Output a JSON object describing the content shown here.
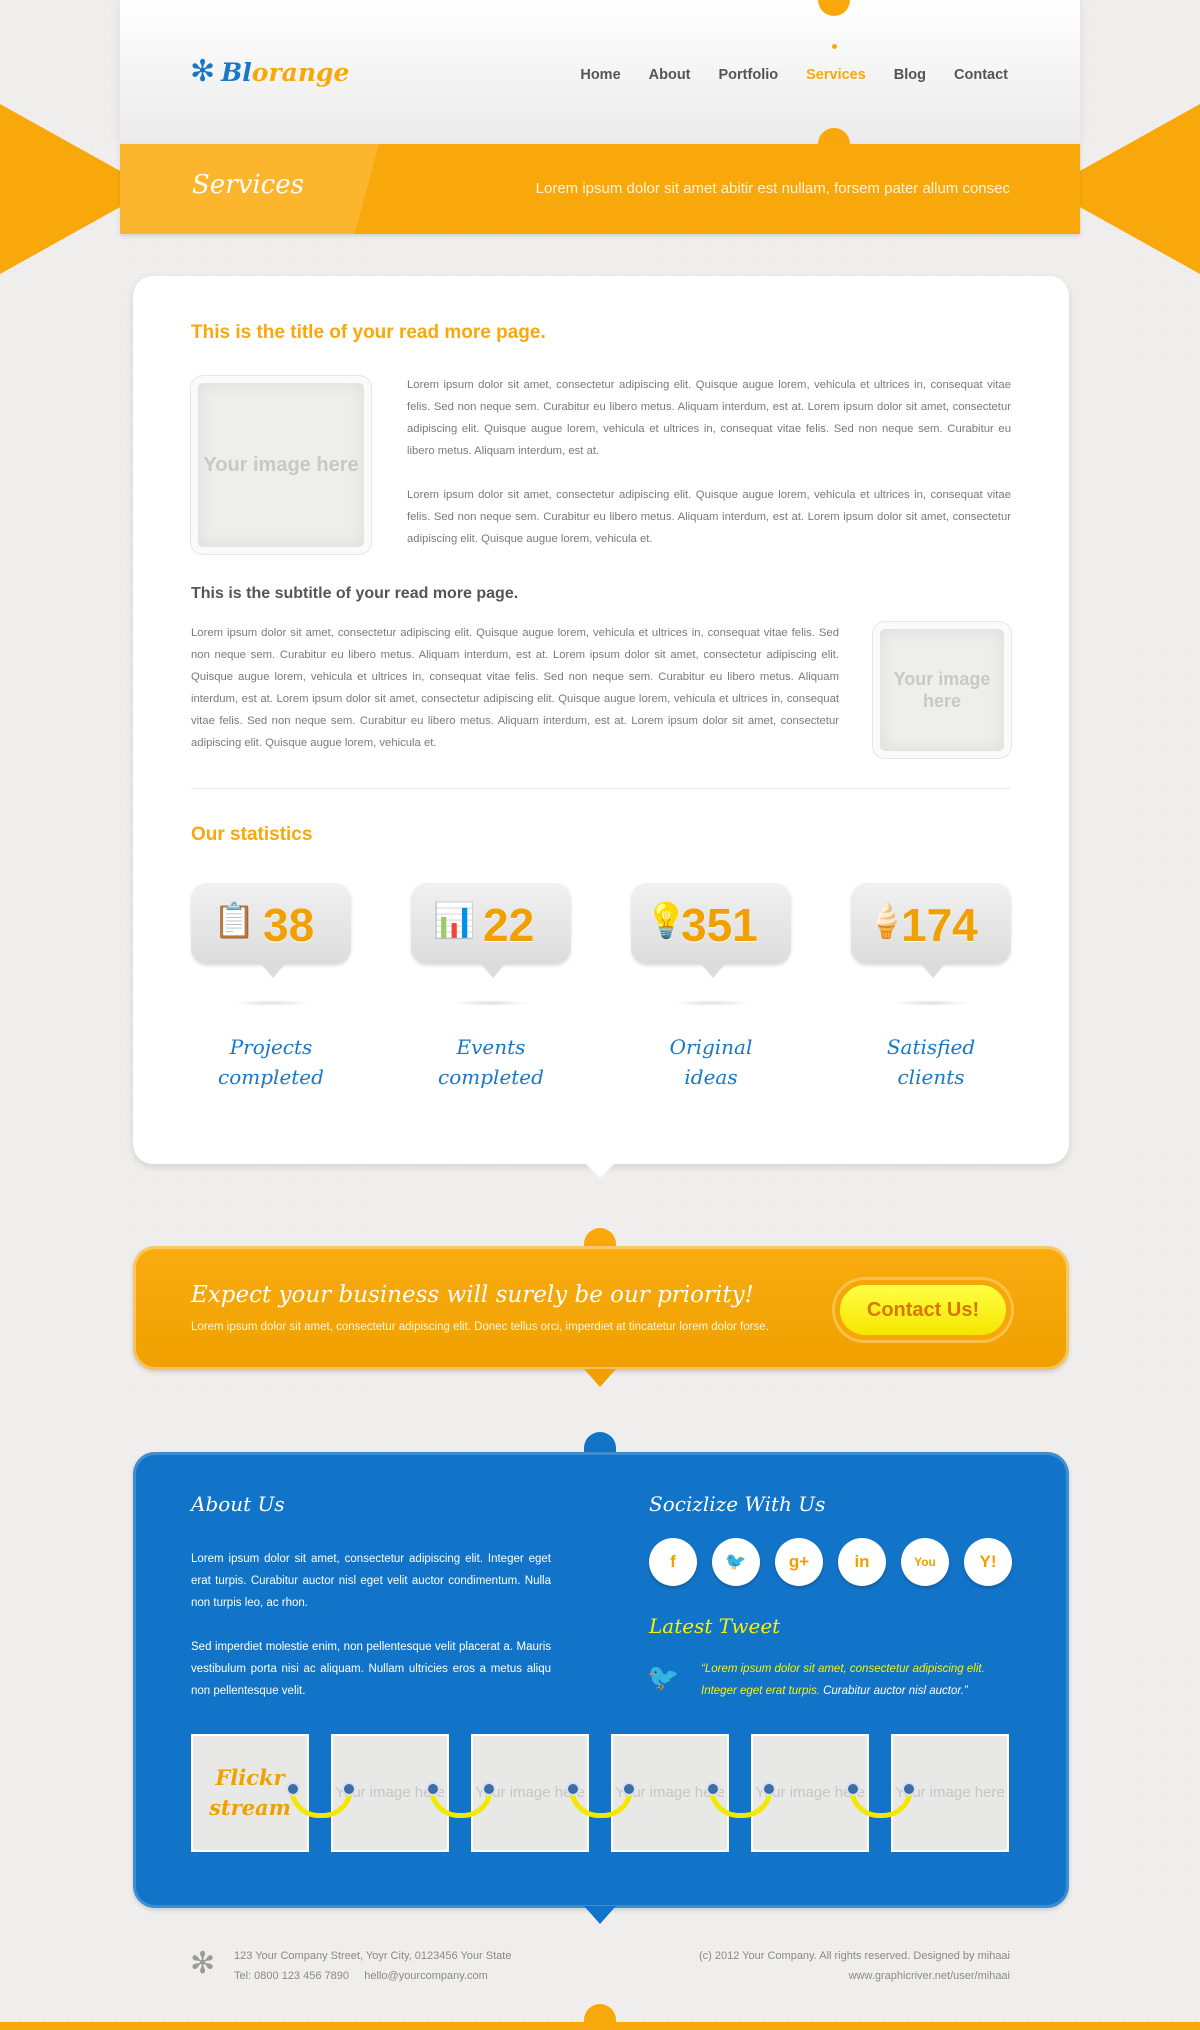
{
  "header": {
    "logo_part1": "Bl",
    "logo_part2": "orange",
    "logo_icon": "flower-icon",
    "nav": [
      "Home",
      "About",
      "Portfolio",
      "Services",
      "Blog",
      "Contact"
    ],
    "active_nav": "Services"
  },
  "banner": {
    "title": "Services",
    "description": "Lorem ipsum dolor sit amet abitir est nullam, forsem pater allum consec"
  },
  "main": {
    "title": "This is the title of your read more page.",
    "image_placeholder": "Your image here",
    "para1": "Lorem ipsum dolor sit amet, consectetur adipiscing elit. Quisque augue lorem, vehicula et ultrices in, consequat vitae felis. Sed non neque sem. Curabitur eu libero metus. Aliquam interdum, est at. Lorem ipsum dolor sit amet, consectetur adipiscing elit. Quisque augue lorem, vehicula et ultrices in, consequat vitae felis. Sed non neque sem. Curabitur eu libero metus. Aliquam interdum, est at.",
    "para2": "Lorem ipsum dolor sit amet, consectetur adipiscing elit. Quisque augue lorem, vehicula et ultrices in, consequat vitae felis. Sed non neque sem. Curabitur eu libero metus. Aliquam interdum, est at. Lorem ipsum dolor sit amet, consectetur adipiscing elit. Quisque augue lorem, vehicula et.",
    "subtitle": "This is the subtitle of your read more page.",
    "para3": "Lorem ipsum dolor sit amet, consectetur adipiscing elit. Quisque augue lorem, vehicula et ultrices in, consequat vitae felis. Sed non neque sem. Curabitur eu libero metus. Aliquam interdum, est at. Lorem ipsum dolor sit amet, consectetur adipiscing elit. Quisque augue lorem, vehicula et ultrices in, consequat vitae felis. Sed non neque sem. Curabitur eu libero metus. Aliquam interdum, est at. Lorem ipsum dolor sit amet, consectetur adipiscing elit. Quisque augue lorem, vehicula et ultrices in, consequat vitae felis. Sed non neque sem. Curabitur eu libero metus. Aliquam interdum, est at. Lorem ipsum dolor sit amet, consectetur adipiscing elit. Quisque augue lorem, vehicula et.",
    "stats_title": "Our statistics",
    "stats": [
      {
        "icon": "clipboard-check-icon",
        "glyph": "📋",
        "value": "38",
        "label1": "Projects",
        "label2": "completed"
      },
      {
        "icon": "presentation-board-icon",
        "glyph": "📊",
        "value": "22",
        "label1": "Events",
        "label2": "completed"
      },
      {
        "icon": "lightbulb-icon",
        "glyph": "💡",
        "value": "351",
        "label1": "Original",
        "label2": "ideas"
      },
      {
        "icon": "ice-cream-icon",
        "glyph": "🍦",
        "value": "174",
        "label1": "Satisfied",
        "label2": "clients"
      }
    ]
  },
  "cta": {
    "title": "Expect your business will surely be our priority!",
    "description": "Lorem ipsum dolor sit amet, consectetur adipiscing elit. Donec tellus orci, imperdiet at tincatetur lorem dolor forse.",
    "button": "Contact Us!"
  },
  "footer_panel": {
    "about_title": "About Us",
    "about_p1": "Lorem ipsum dolor sit amet, consectetur adipiscing elit. Integer eget erat turpis. Curabitur auctor nisl eget velit auctor condimentum. Nulla non turpis leo, ac rhon.",
    "about_p2": "Sed imperdiet molestie enim, non pellentesque velit placerat a. Mauris vestibulum porta nisi ac aliquam. Nullam ultricies eros a metus aliqu non pellentesque velit.",
    "social_title": "Socizlize With Us",
    "socials": [
      {
        "icon": "facebook-icon",
        "glyph": "f"
      },
      {
        "icon": "twitter-icon",
        "glyph": "🐦"
      },
      {
        "icon": "google-plus-icon",
        "glyph": "g+"
      },
      {
        "icon": "linkedin-icon",
        "glyph": "in"
      },
      {
        "icon": "youtube-icon",
        "glyph": "You"
      },
      {
        "icon": "yahoo-icon",
        "glyph": "Y!"
      }
    ],
    "tweet_title": "Latest Tweet",
    "tweet_highlight": "“Lorem ipsum dolor sit amet, consectetur adipiscing elit. Integer eget erat turpis.",
    "tweet_rest": " Curabitur auctor nisl auctor.”",
    "flickr_label": "Flickr stream",
    "flickr_placeholder": "Your image here"
  },
  "page_footer": {
    "address": "123 Your Company Street, Yoyr City, 0123456 Your State",
    "phone": "Tel: 0800 123 456 7890",
    "email": "hello@yourcompany.com",
    "copyright": "(c) 2012 Your Company. All rights reserved. Designed by mihaai",
    "url": "www.graphicriver.net/user/mihaai"
  },
  "colors": {
    "accent": "#f9a80b",
    "blue": "#1274c9",
    "yellow": "#f7f200"
  }
}
